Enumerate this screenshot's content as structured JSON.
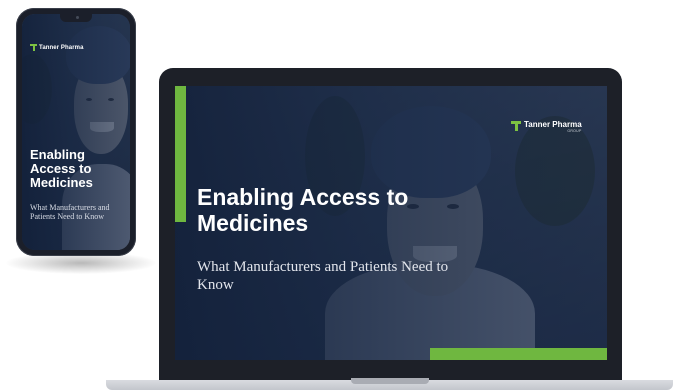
{
  "brand": {
    "name": "Tanner Pharma",
    "group": "GROUP",
    "accent_color": "#6fb740",
    "navy_color": "#1c2c4a"
  },
  "phone": {
    "title": "Enabling Access to Medicines",
    "subtitle": "What Manufacturers and Patients Need to Know"
  },
  "laptop": {
    "title": "Enabling Access to Medicines",
    "subtitle": "What Manufacturers and Patients Need to Know"
  }
}
